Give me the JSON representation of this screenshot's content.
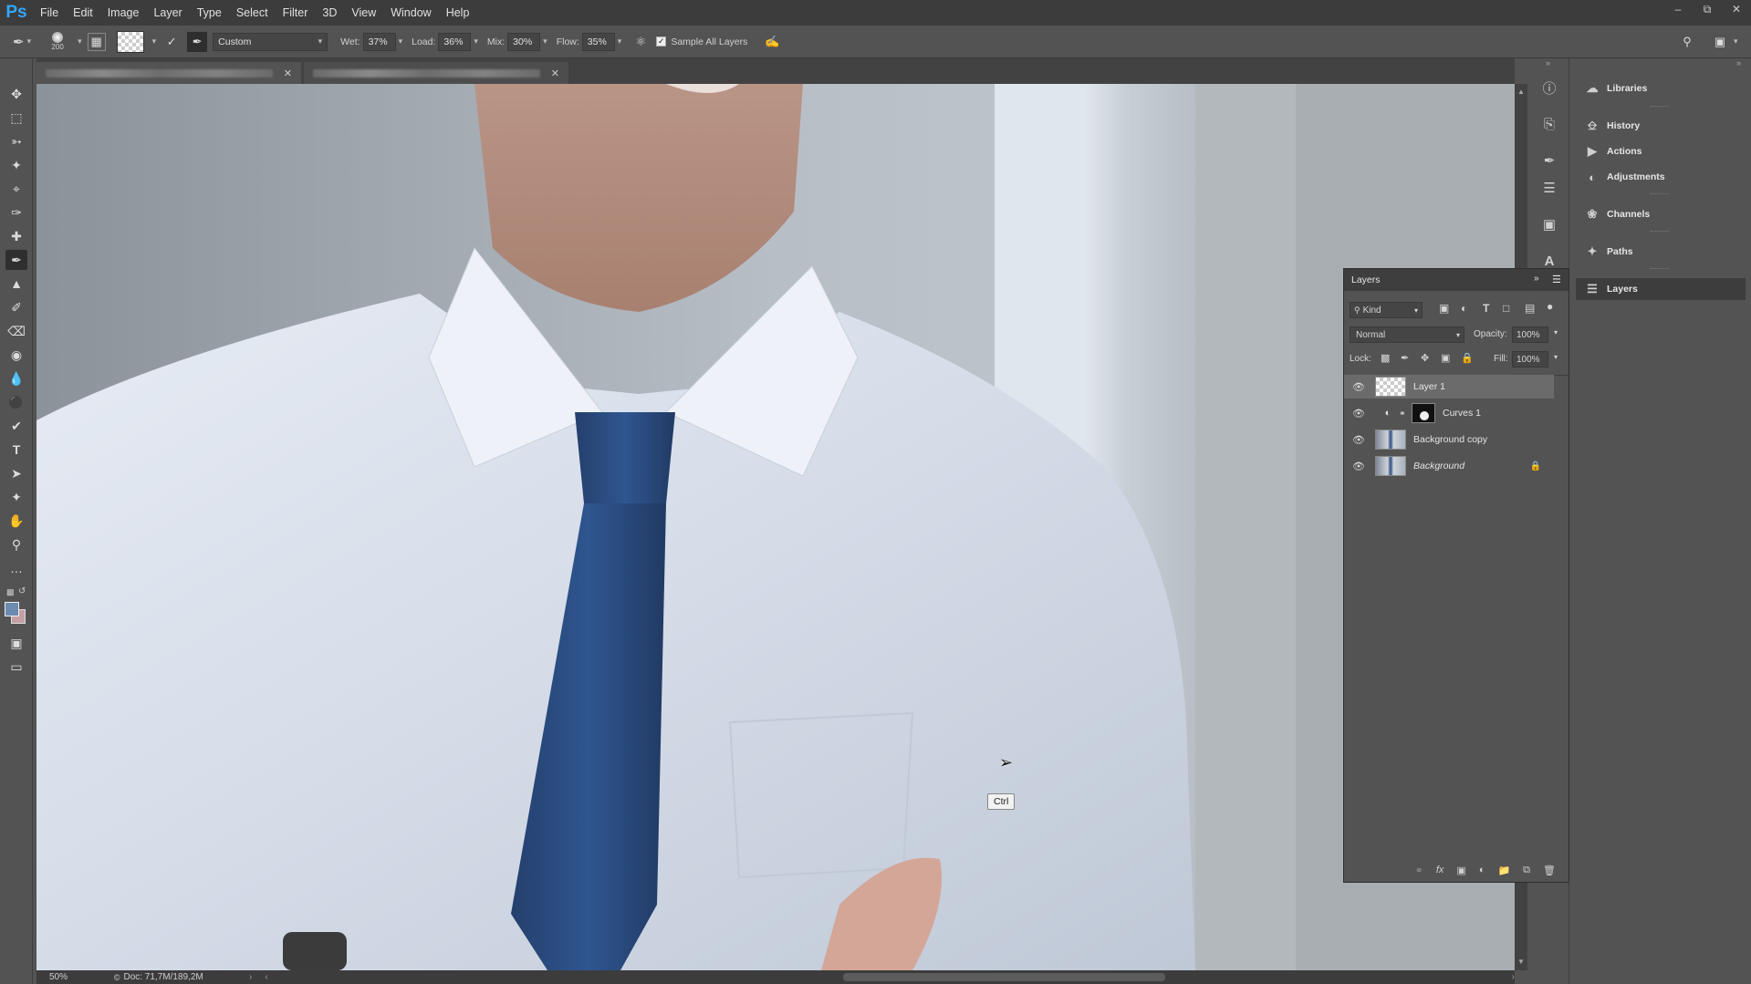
{
  "app": {
    "logo": "Ps",
    "menu": [
      "File",
      "Edit",
      "Image",
      "Layer",
      "Type",
      "Select",
      "Filter",
      "3D",
      "View",
      "Window",
      "Help"
    ]
  },
  "options_bar": {
    "brush_size": "200",
    "preset": "Custom",
    "wet_label": "Wet:",
    "wet_value": "37%",
    "load_label": "Load:",
    "load_value": "36%",
    "mix_label": "Mix:",
    "mix_value": "30%",
    "flow_label": "Flow:",
    "flow_value": "35%",
    "sample_all_layers": "Sample All Layers",
    "sample_all_checked": true
  },
  "status_bar": {
    "zoom": "50%",
    "doc_info": "Doc: 71,7M/189,2M"
  },
  "tooltip": "Ctrl",
  "panels": {
    "libraries": "Libraries",
    "history": "History",
    "actions": "Actions",
    "adjustments": "Adjustments",
    "channels": "Channels",
    "paths": "Paths",
    "layers": "Layers"
  },
  "layers_panel": {
    "title": "Layers",
    "filter_kind": "Kind",
    "blend_mode": "Normal",
    "opacity_label": "Opacity:",
    "opacity_value": "100%",
    "lock_label": "Lock:",
    "fill_label": "Fill:",
    "fill_value": "100%",
    "layers": [
      {
        "name": "Layer 1",
        "selected": true
      },
      {
        "name": "Curves 1",
        "selected": false
      },
      {
        "name": "Background copy",
        "selected": false
      },
      {
        "name": "Background",
        "selected": false,
        "locked": true
      }
    ]
  },
  "colors": {
    "accent": "#31a8ff",
    "foreground_swatch": "#6b8bb0",
    "background_swatch": "#c4a0a4"
  }
}
